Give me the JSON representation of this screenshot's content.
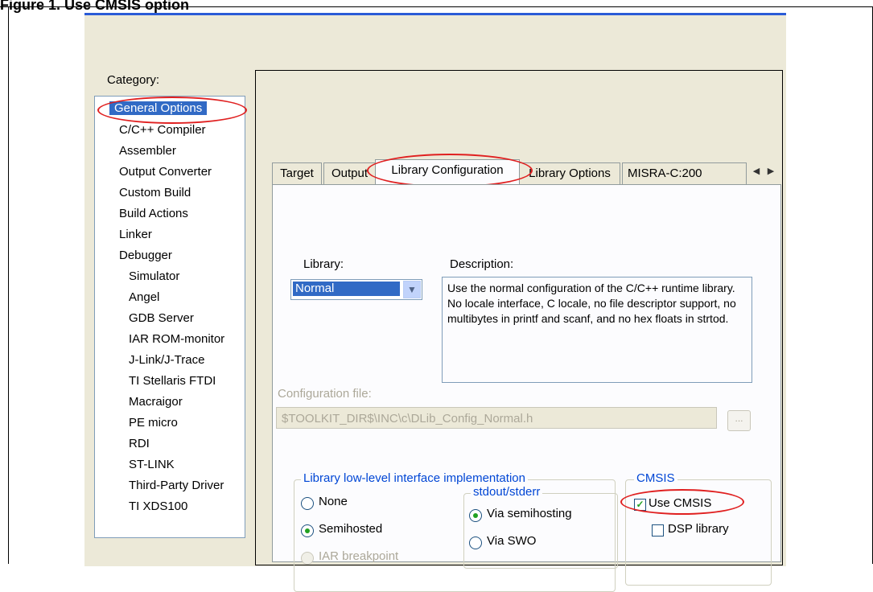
{
  "caption": "Figure 1.    Use CMSIS option",
  "category": {
    "label": "Category:",
    "items": [
      {
        "label": "General Options",
        "selected": true,
        "indent": 0
      },
      {
        "label": "C/C++ Compiler",
        "indent": 0
      },
      {
        "label": "Assembler",
        "indent": 0
      },
      {
        "label": "Output Converter",
        "indent": 0
      },
      {
        "label": "Custom Build",
        "indent": 0
      },
      {
        "label": "Build Actions",
        "indent": 0
      },
      {
        "label": "Linker",
        "indent": 0
      },
      {
        "label": "Debugger",
        "indent": 0
      },
      {
        "label": "Simulator",
        "indent": 1
      },
      {
        "label": "Angel",
        "indent": 1
      },
      {
        "label": "GDB Server",
        "indent": 1
      },
      {
        "label": "IAR ROM-monitor",
        "indent": 1
      },
      {
        "label": "J-Link/J-Trace",
        "indent": 1
      },
      {
        "label": "TI Stellaris FTDI",
        "indent": 1
      },
      {
        "label": "Macraigor",
        "indent": 1
      },
      {
        "label": "PE micro",
        "indent": 1
      },
      {
        "label": "RDI",
        "indent": 1
      },
      {
        "label": "ST-LINK",
        "indent": 1
      },
      {
        "label": "Third-Party Driver",
        "indent": 1
      },
      {
        "label": "TI XDS100",
        "indent": 1
      }
    ]
  },
  "tabs": [
    {
      "label": "Target"
    },
    {
      "label": "Output"
    },
    {
      "label": "Library Configuration",
      "active": true
    },
    {
      "label": "Library Options"
    },
    {
      "label": "MISRA-C:200"
    }
  ],
  "tab_scroll": {
    "left_icon": "chevron-left-icon",
    "right_icon": "chevron-right-icon"
  },
  "library": {
    "label": "Library:",
    "value": "Normal"
  },
  "description": {
    "label": "Description:",
    "text": "Use the normal configuration of the C/C++ runtime library. No locale interface, C locale, no file descriptor support, no multibytes in printf and scanf, and no hex floats in strtod."
  },
  "config_file": {
    "label": "Configuration file:",
    "value": "$TOOLKIT_DIR$\\INC\\c\\DLib_Config_Normal.h",
    "browse_label": "..."
  },
  "lowlevel": {
    "legend": "Library low-level interface implementation",
    "options": [
      {
        "label": "None",
        "checked": false,
        "disabled": false
      },
      {
        "label": "Semihosted",
        "checked": true,
        "disabled": false
      },
      {
        "label": "IAR breakpoint",
        "checked": false,
        "disabled": true
      }
    ]
  },
  "stdout": {
    "legend": "stdout/stderr",
    "options": [
      {
        "label": "Via semihosting",
        "checked": true
      },
      {
        "label": "Via SWO",
        "checked": false
      }
    ]
  },
  "cmsis": {
    "legend": "CMSIS",
    "use_cmsis": {
      "label": "Use CMSIS",
      "checked": true
    },
    "dsp_library": {
      "label": "DSP library",
      "checked": false
    }
  },
  "colors": {
    "highlight": "#316ac5",
    "annotation": "#e02020",
    "group_legend": "#0046d5"
  }
}
